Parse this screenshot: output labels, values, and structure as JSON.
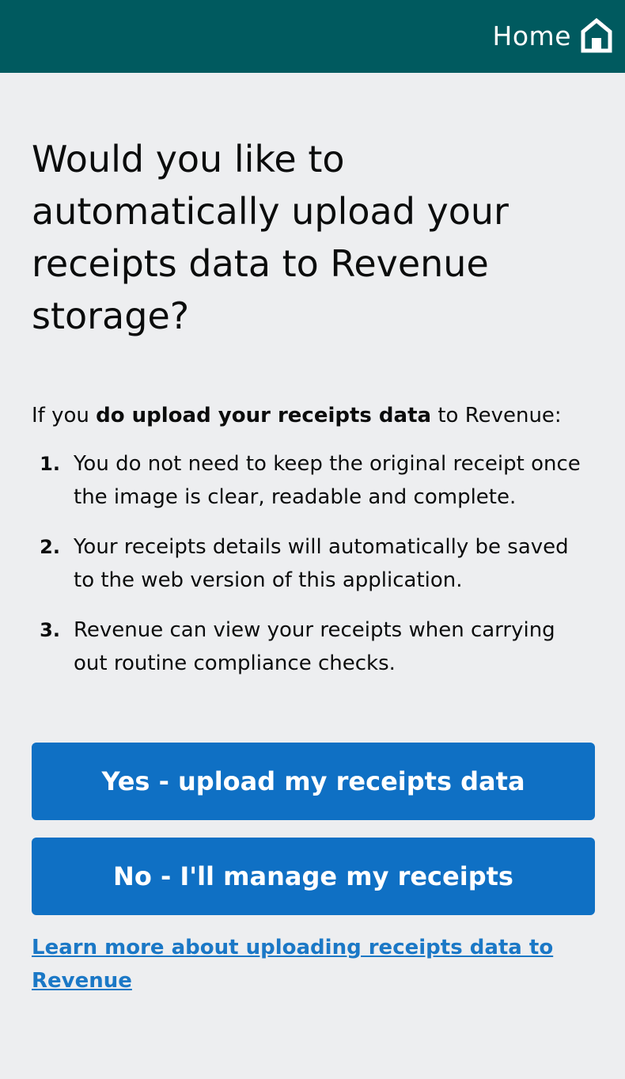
{
  "header": {
    "home_label": "Home",
    "home_icon": "home-icon",
    "background_color": "#005a5f"
  },
  "main": {
    "title": "Would you like to automatically upload your receipts data to Revenue storage?",
    "intro": {
      "prefix": "If you ",
      "emphasis": "do upload your receipts data",
      "suffix": " to Revenue:"
    },
    "steps": [
      {
        "number": "1.",
        "text": "You do not need to keep the original receipt once the image is clear, readable and complete."
      },
      {
        "number": "2.",
        "text": "Your receipts details will automatically be saved to the web version of this application."
      },
      {
        "number": "3.",
        "text": "Revenue can view your receipts when carrying out routine compliance checks."
      }
    ]
  },
  "actions": {
    "yes_label": "Yes - upload my receipts data",
    "no_label": "No - I'll manage my receipts",
    "learn_more_label": "Learn more about uploading receipts data to Revenue",
    "button_color": "#0f70c4",
    "link_color": "#1b78c6"
  }
}
